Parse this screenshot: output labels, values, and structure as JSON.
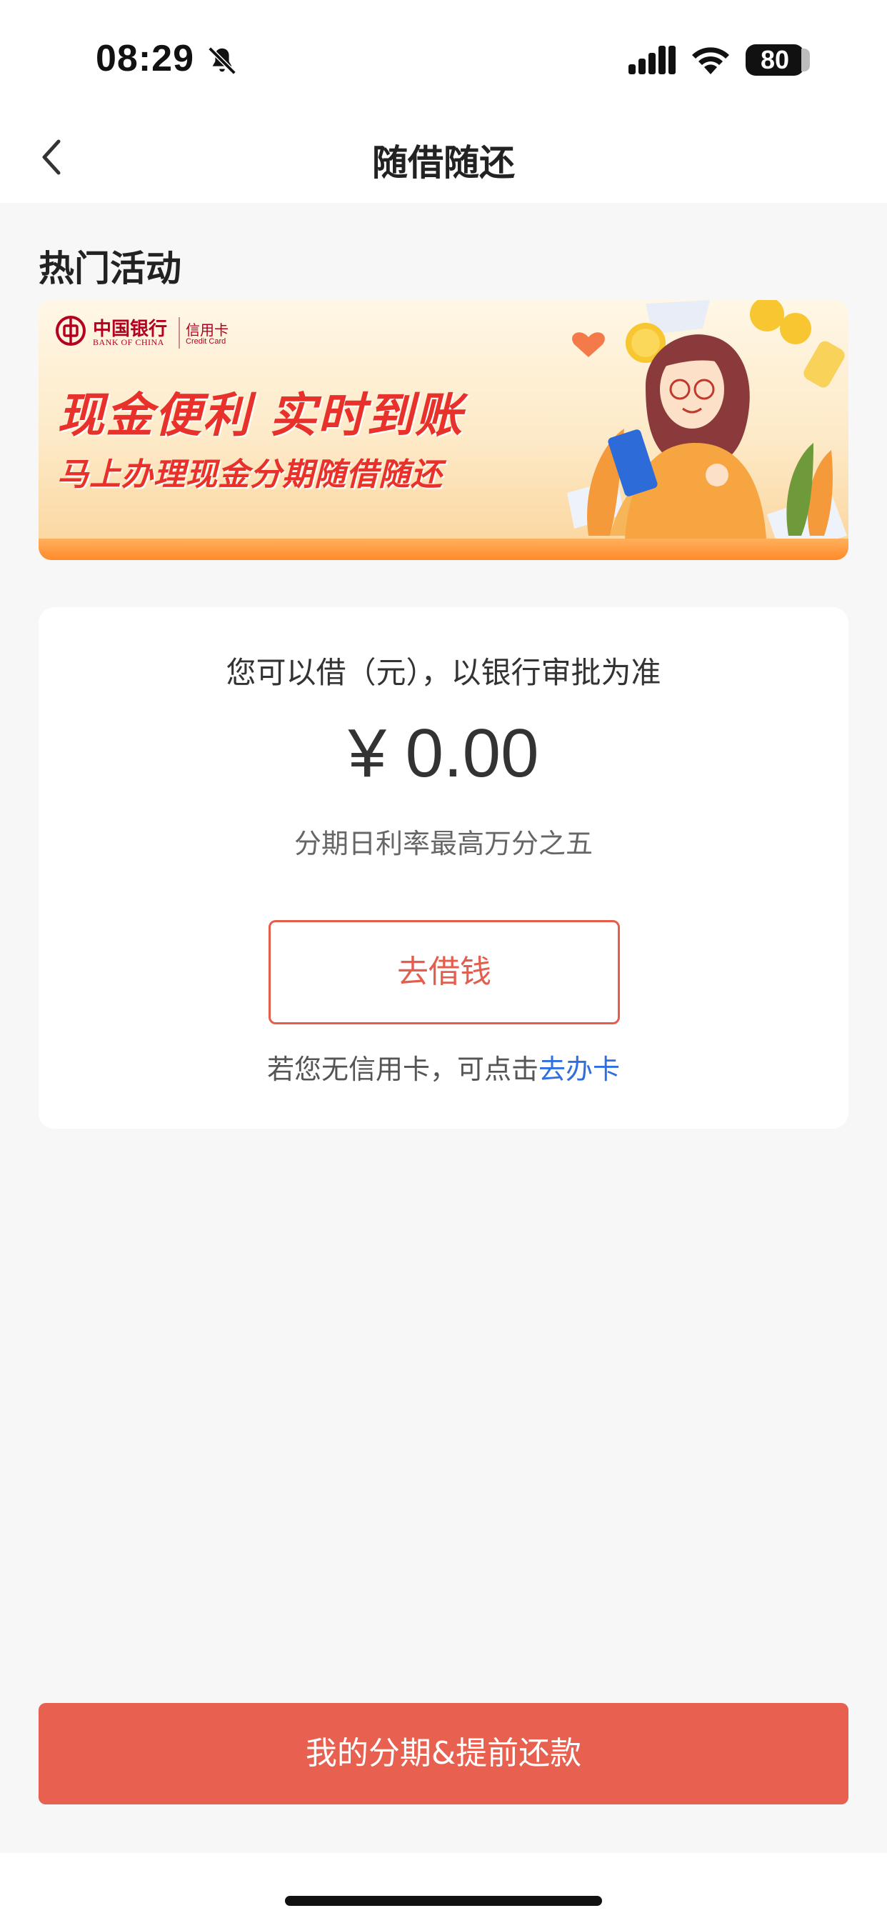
{
  "status_bar": {
    "time": "08:29",
    "battery": "80",
    "icons": [
      "bell-slash-icon",
      "signal-icon",
      "wifi-icon",
      "battery-icon"
    ]
  },
  "nav": {
    "title": "随借随还",
    "back_icon": "chevron-left-icon"
  },
  "section": {
    "title": "热门活动"
  },
  "banner": {
    "bank_name": "中国银行",
    "bank_name_en": "BANK OF CHINA",
    "card_label": "信用卡",
    "card_label_en": "Credit Card",
    "headline": "现金便利  实时到账",
    "subline": "马上办理现金分期随借随还",
    "colors": {
      "headline": "#e8312a",
      "bank": "#b4001e"
    }
  },
  "loan_card": {
    "label": "您可以借（元），以银行审批为准",
    "amount": "¥ 0.00",
    "rate_note": "分期日利率最高万分之五",
    "borrow_button": "去借钱",
    "apply_prefix": "若您无信用卡，可点击",
    "apply_link": "去办卡",
    "colors": {
      "accent": "#e45d4d",
      "link": "#2f6fe0"
    }
  },
  "bottom": {
    "button": "我的分期&提前还款",
    "color": "#e8604f"
  }
}
